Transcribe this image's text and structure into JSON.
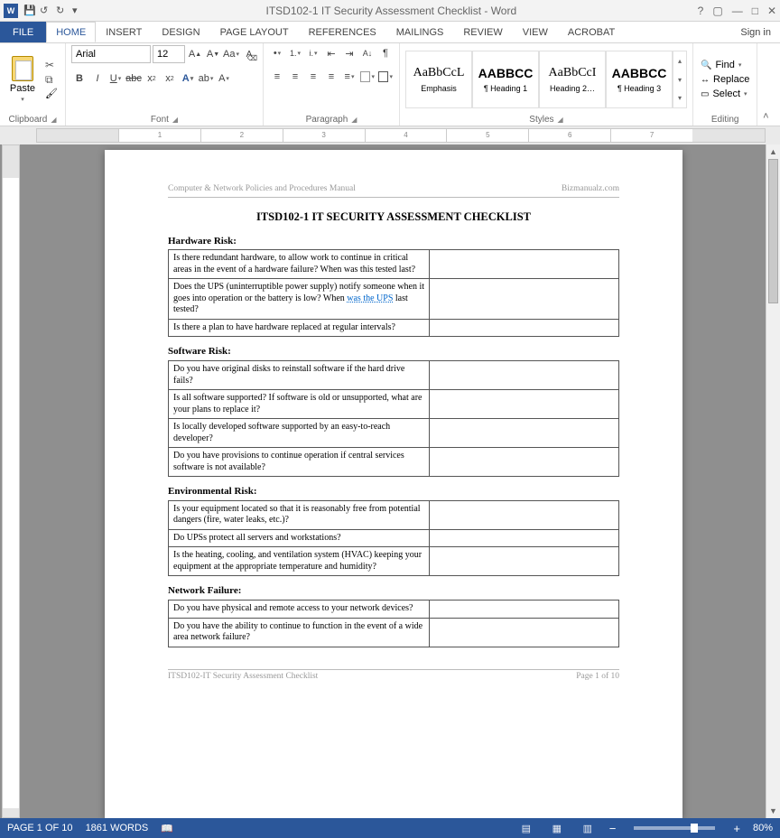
{
  "titlebar": {
    "app_short": "W",
    "title": "ITSD102-1 IT Security Assessment Checklist - Word"
  },
  "tabs": {
    "file": "FILE",
    "list": [
      "HOME",
      "INSERT",
      "DESIGN",
      "PAGE LAYOUT",
      "REFERENCES",
      "MAILINGS",
      "REVIEW",
      "VIEW",
      "ACROBAT"
    ],
    "signin": "Sign in"
  },
  "ribbon": {
    "clipboard": {
      "paste_label": "Paste",
      "group": "Clipboard"
    },
    "font": {
      "name": "Arial",
      "size": "12",
      "group": "Font"
    },
    "paragraph": {
      "group": "Paragraph"
    },
    "styles": {
      "group": "Styles",
      "items": [
        {
          "preview": "AaBbCcL",
          "label": "Emphasis",
          "cls": ""
        },
        {
          "preview": "AABBCC",
          "label": "¶ Heading 1",
          "cls": "bold"
        },
        {
          "preview": "AaBbCcI",
          "label": "Heading 2…",
          "cls": "h2"
        },
        {
          "preview": "AABBCC",
          "label": "¶ Heading 3",
          "cls": "bold"
        }
      ]
    },
    "editing": {
      "find": "Find",
      "replace": "Replace",
      "select": "Select",
      "group": "Editing"
    }
  },
  "ruler": {
    "numbers": [
      "1",
      "2",
      "3",
      "4",
      "5",
      "6",
      "7"
    ]
  },
  "document": {
    "header_left": "Computer & Network Policies and Procedures Manual",
    "header_right": "Bizmanualz.com",
    "title": "ITSD102-1   IT SECURITY ASSESSMENT CHECKLIST",
    "sections": [
      {
        "title": "Hardware Risk:",
        "rows": [
          "Is there redundant hardware, to allow work to continue in critical areas in the event of a hardware failure?  When was this tested last?",
          "Does the UPS (uninterruptible power supply) notify someone when it goes into operation or the battery is low? When <span class='link'>was the UPS</span> last tested?",
          "Is there a plan to have hardware replaced at regular intervals?"
        ]
      },
      {
        "title": "Software Risk:",
        "rows": [
          "Do you have original disks to reinstall software if the hard drive fails?",
          "Is all software supported?  If software is old or unsupported, what are your plans to replace it?",
          "Is locally developed software supported by an easy-to-reach developer?",
          "Do you have provisions to continue operation if central services software is not available?"
        ]
      },
      {
        "title": "Environmental Risk:",
        "rows": [
          "Is your equipment located so that it is reasonably free from potential dangers (fire, water leaks, etc.)?",
          "Do UPSs protect all servers and workstations?",
          "Is the heating, cooling, and ventilation system (HVAC) keeping your equipment at the appropriate temperature and humidity?"
        ]
      },
      {
        "title": "Network Failure:",
        "rows": [
          "Do you have physical and remote access to your network devices?",
          "Do you have the ability to continue to function in the event of a wide area network failure?"
        ]
      }
    ],
    "footer_left": "ITSD102-IT Security Assessment Checklist",
    "footer_right": "Page 1 of 10"
  },
  "statusbar": {
    "page": "PAGE 1 OF 10",
    "words": "1861 WORDS",
    "zoom": "80%"
  }
}
